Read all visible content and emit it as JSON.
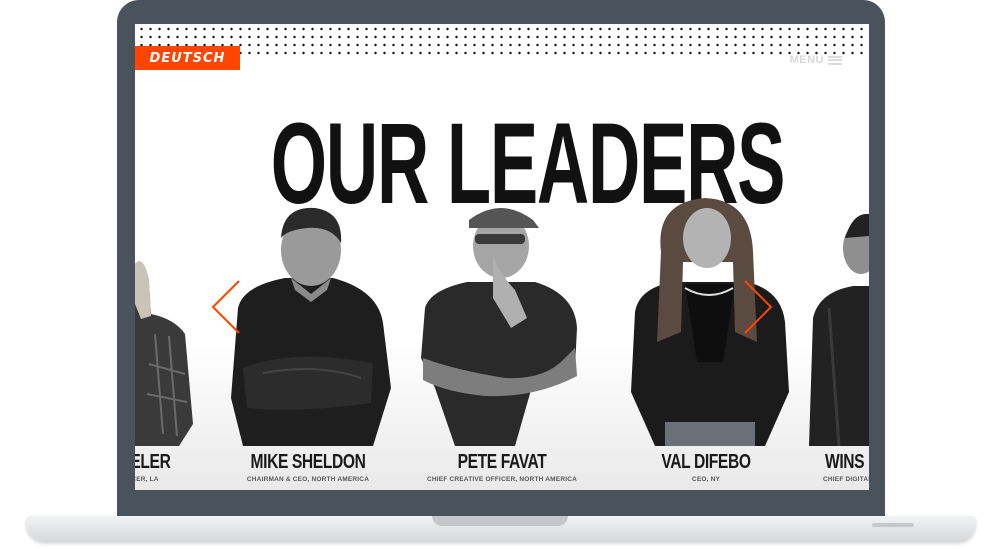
{
  "site": {
    "logo_text": "DEUTSCH",
    "menu_label": "MENU",
    "headline": "OUR LEADERS"
  },
  "leaders": [
    {
      "name": "DELER",
      "role": "CER, LA"
    },
    {
      "name": "MIKE SHELDON",
      "role": "CHAIRMAN & CEO, NORTH AMERICA"
    },
    {
      "name": "PETE FAVAT",
      "role": "CHIEF CREATIVE OFFICER, NORTH AMERICA"
    },
    {
      "name": "VAL DIFEBO",
      "role": "CEO, NY"
    },
    {
      "name": "WINS",
      "role": "CHIEF DIGITAL"
    }
  ],
  "carousel": {
    "prev_icon": "chevron-left-icon",
    "next_icon": "chevron-right-icon",
    "arrow_color": "#ff4500"
  },
  "colors": {
    "brand": "#ff4500",
    "frame": "#4a525c",
    "headline": "#111111"
  }
}
